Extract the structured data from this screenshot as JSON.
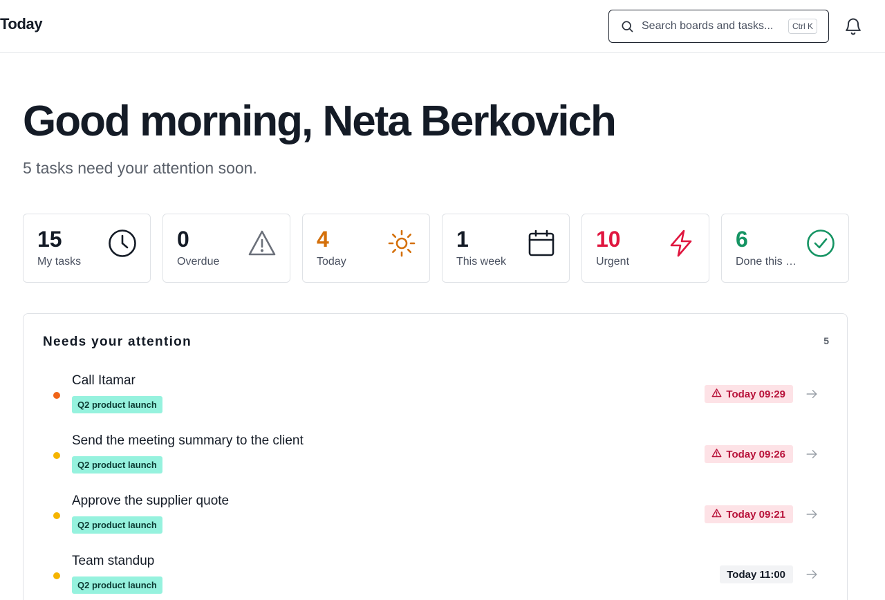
{
  "header": {
    "page_title": "Today",
    "search_placeholder": "Search boards and tasks...",
    "search_shortcut": "Ctrl K"
  },
  "greeting": {
    "title": "Good morning, Neta Berkovich",
    "subtitle": "5 tasks need your attention soon."
  },
  "stats": [
    {
      "value": "15",
      "label": "My tasks",
      "icon": "clock-icon",
      "color": "#141b26"
    },
    {
      "value": "0",
      "label": "Overdue",
      "icon": "warning-icon",
      "color": "#141b26"
    },
    {
      "value": "4",
      "label": "Today",
      "icon": "sun-icon",
      "color": "#d4700b"
    },
    {
      "value": "1",
      "label": "This week",
      "icon": "calendar-icon",
      "color": "#141b26"
    },
    {
      "value": "10",
      "label": "Urgent",
      "icon": "lightning-icon",
      "color": "#e0163f"
    },
    {
      "value": "6",
      "label": "Done this week",
      "icon": "check-circle-icon",
      "color": "#159463"
    }
  ],
  "attention": {
    "title": "Needs your attention",
    "count": "5",
    "tasks": [
      {
        "title": "Call Itamar",
        "tag": "Q2 product launch",
        "due": "Today 09:29",
        "overdue": true,
        "dot_color": "#f06418"
      },
      {
        "title": "Send the meeting summary to the client",
        "tag": "Q2 product launch",
        "due": "Today 09:26",
        "overdue": true,
        "dot_color": "#f5b400"
      },
      {
        "title": "Approve the supplier quote",
        "tag": "Q2 product launch",
        "due": "Today 09:21",
        "overdue": true,
        "dot_color": "#f5b400"
      },
      {
        "title": "Team standup",
        "tag": "Q2 product launch",
        "due": "Today 11:00",
        "overdue": false,
        "dot_color": "#f5b400"
      }
    ]
  }
}
